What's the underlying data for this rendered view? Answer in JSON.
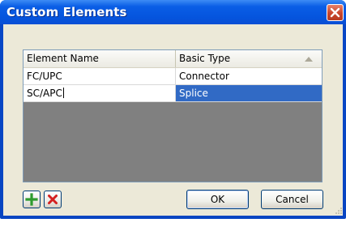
{
  "window": {
    "title": "Custom Elements"
  },
  "grid": {
    "columns": [
      "Element Name",
      "Basic Type"
    ],
    "rows": [
      {
        "name": "FC/UPC",
        "type": "Connector"
      },
      {
        "name": "SC/APC",
        "type": "Splice"
      }
    ]
  },
  "buttons": {
    "ok": "OK",
    "cancel": "Cancel"
  },
  "icons": {
    "add": "plus-icon",
    "remove": "x-icon",
    "close": "close-icon"
  },
  "colors": {
    "title_bar": "#0a5ee6",
    "selection": "#316ac5",
    "add_icon": "#2e9b2e",
    "remove_icon": "#d42020",
    "close_button": "#c8452c"
  }
}
